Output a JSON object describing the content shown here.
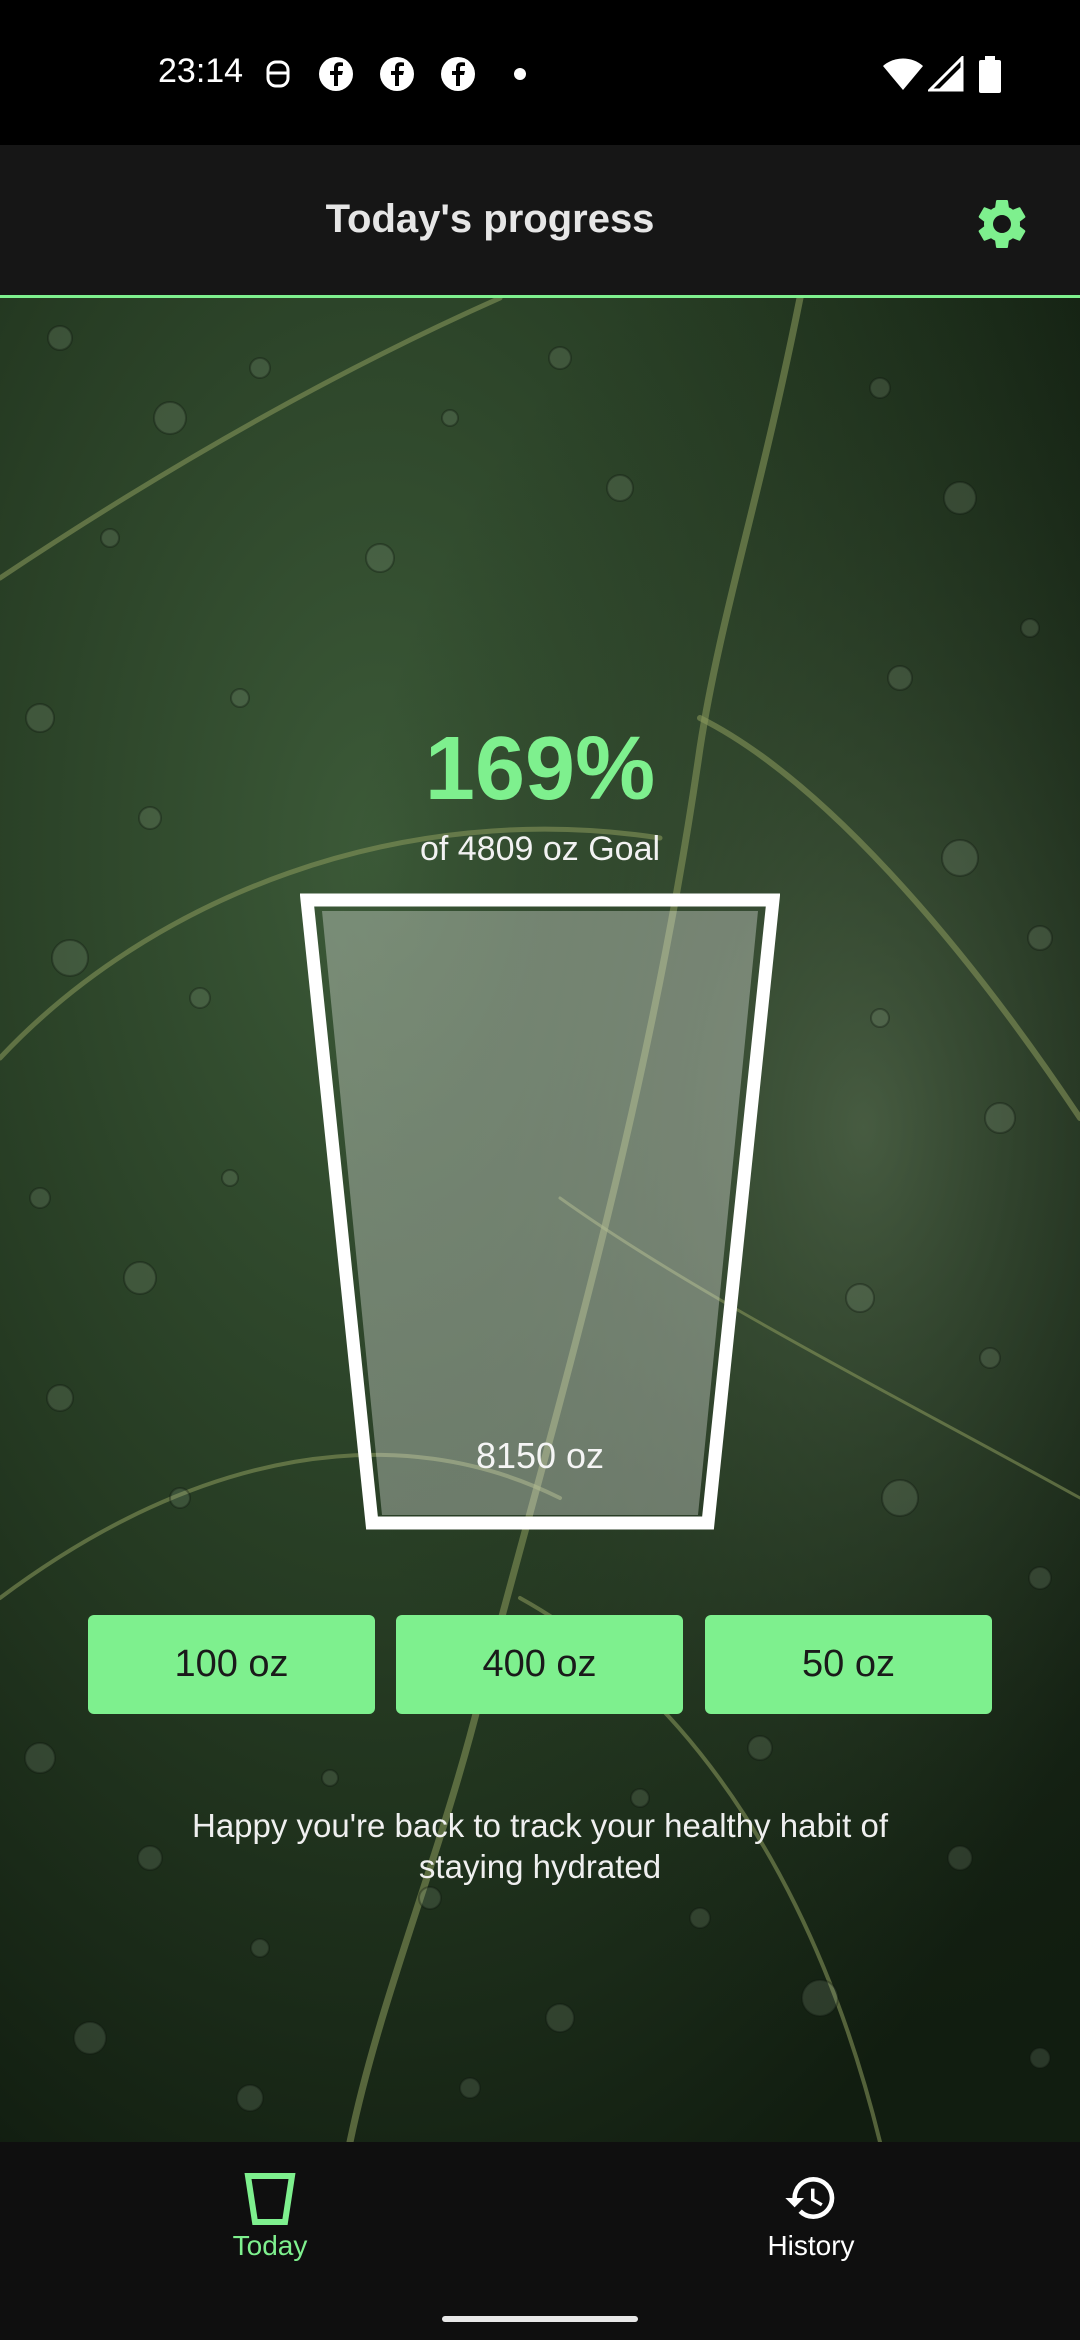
{
  "status_bar": {
    "time": "23:14",
    "left_icons": [
      "notification-icon",
      "facebook-icon",
      "facebook-icon",
      "facebook-icon",
      "dot-icon"
    ],
    "right_icons": [
      "wifi-icon",
      "signal-icon",
      "battery-icon"
    ]
  },
  "app_bar": {
    "title": "Today's progress",
    "settings_icon": "gear-icon"
  },
  "progress": {
    "percent": "169%",
    "goal_text": "of 4809 oz Goal",
    "amount": "8150 oz",
    "fill_fraction": 1.0
  },
  "buttons": [
    {
      "label": "100 oz"
    },
    {
      "label": "400 oz"
    },
    {
      "label": "50 oz"
    }
  ],
  "message": "Happy you're back to track your healthy habit of staying hydrated",
  "bottom_nav": {
    "items": [
      {
        "label": "Today",
        "icon": "cup-icon",
        "active": true
      },
      {
        "label": "History",
        "icon": "history-icon",
        "active": false
      }
    ]
  },
  "colors": {
    "accent": "#7ef08e",
    "app_bar": "#161616",
    "nav_bar": "#0f0f0f"
  }
}
